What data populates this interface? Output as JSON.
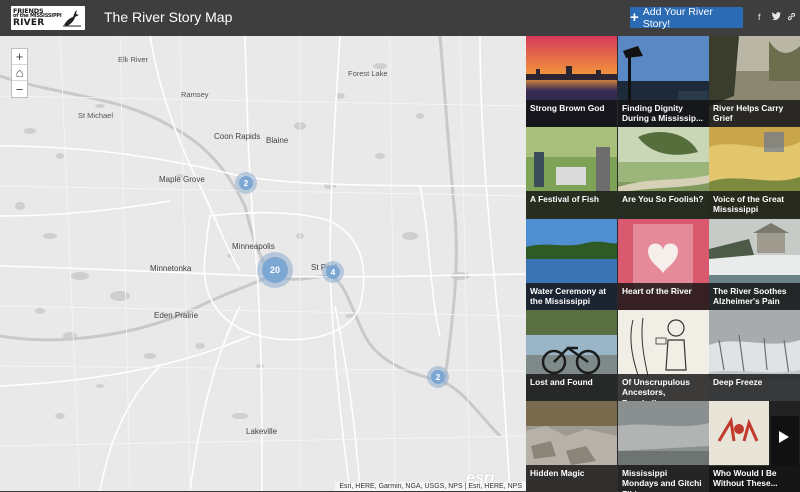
{
  "header": {
    "logo": {
      "line1": "FRIENDS",
      "line2": "of the MISSISSIPPI",
      "line3": "RIVER"
    },
    "title": "The River Story Map",
    "add_button": "Add Your River Story!",
    "social": {
      "facebook": "f",
      "twitter": "t",
      "link": "link"
    }
  },
  "map": {
    "zoom": {
      "in": "+",
      "home": "⌂",
      "out": "−"
    },
    "cities": [
      "Elk River",
      "Forest Lake",
      "Ramsey",
      "St Michael",
      "Coon Rapids",
      "Blaine",
      "Maple Grove",
      "Minneapolis",
      "Minnetonka",
      "St Paul",
      "Eden Prairie",
      "Lakeville"
    ],
    "clusters": [
      {
        "label": "2"
      },
      {
        "label": "20"
      },
      {
        "label": "4"
      },
      {
        "label": "2"
      }
    ],
    "attribution": "Esri, HERE, Garmin, NGA, USGS, NPS | Esri, HERE, NPS",
    "esri": "esri"
  },
  "stories": [
    {
      "title": "Strong Brown God"
    },
    {
      "title": "Finding Dignity During a Mississip..."
    },
    {
      "title": "River Helps Carry Grief"
    },
    {
      "title": "A Festival of Fish"
    },
    {
      "title": "Are You So Foolish?"
    },
    {
      "title": "Voice of the Great Mississippi"
    },
    {
      "title": "Water Ceremony at the Mississippi"
    },
    {
      "title": "Heart of the River"
    },
    {
      "title": "The River Soothes Alzheimer's Pain"
    },
    {
      "title": "Lost and Found"
    },
    {
      "title": "Of Unscrupulous Ancestors, Baseball..."
    },
    {
      "title": "Deep Freeze"
    },
    {
      "title": "Hidden Magic"
    },
    {
      "title": "Mississippi Mondays and Gitchi Zibi"
    },
    {
      "title": "Who Would I Be Without These..."
    }
  ],
  "colors": {
    "header": "#3e3e3e",
    "accent": "#2a6bb3",
    "cluster": "#7da7d3",
    "map": "#e8e8e8"
  }
}
